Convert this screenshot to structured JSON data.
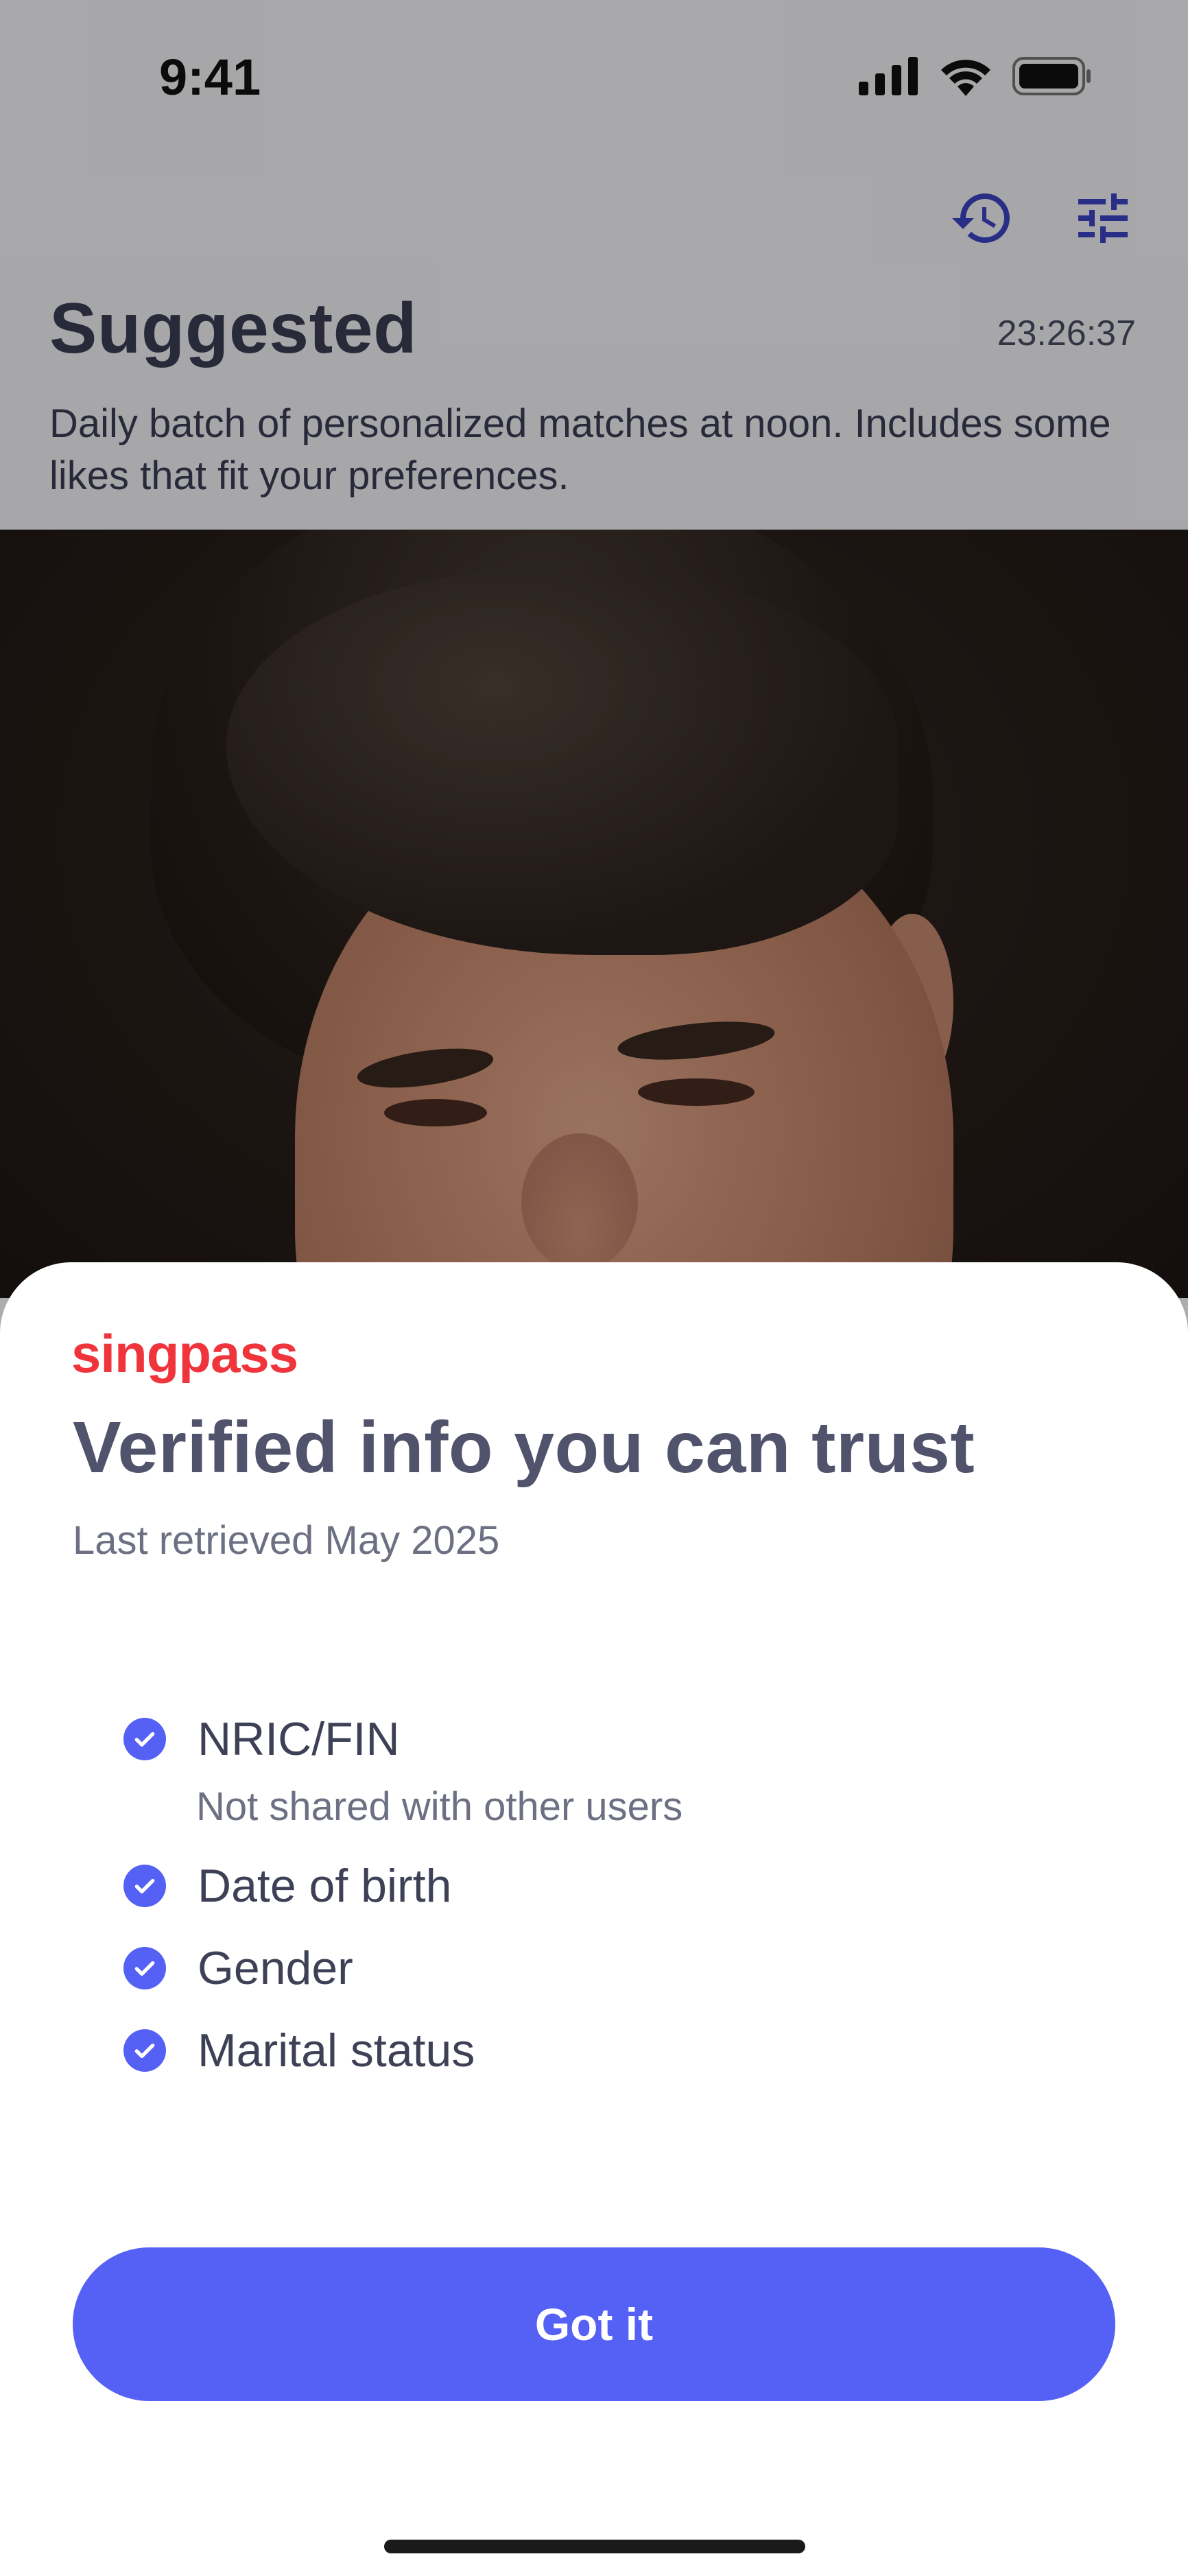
{
  "status_bar": {
    "time": "9:41",
    "icons": [
      "signal-icon",
      "wifi-icon",
      "battery-icon"
    ]
  },
  "header": {
    "title": "Suggested",
    "countdown": "23:26:37",
    "subtitle": "Daily batch of personalized matches at noon. Includes some likes that fit your preferences.",
    "actions": [
      "history-icon",
      "filter-icon"
    ]
  },
  "photo": {
    "icon": "profile-photo"
  },
  "sheet": {
    "brand": "singpass",
    "title": "Verified info you can trust",
    "subtitle": "Last retrieved May 2025",
    "items": [
      {
        "label": "NRIC/FIN",
        "note": "Not shared with other users",
        "icon": "check-circle-icon"
      },
      {
        "label": "Date of birth",
        "icon": "check-circle-icon"
      },
      {
        "label": "Gender",
        "icon": "check-circle-icon"
      },
      {
        "label": "Marital status",
        "icon": "check-circle-icon"
      }
    ],
    "button_label": "Got it"
  },
  "colors": {
    "accent": "#5560f5",
    "brand_red": "#f0343c",
    "overlay": "rgba(0,0,0,0.32)"
  }
}
